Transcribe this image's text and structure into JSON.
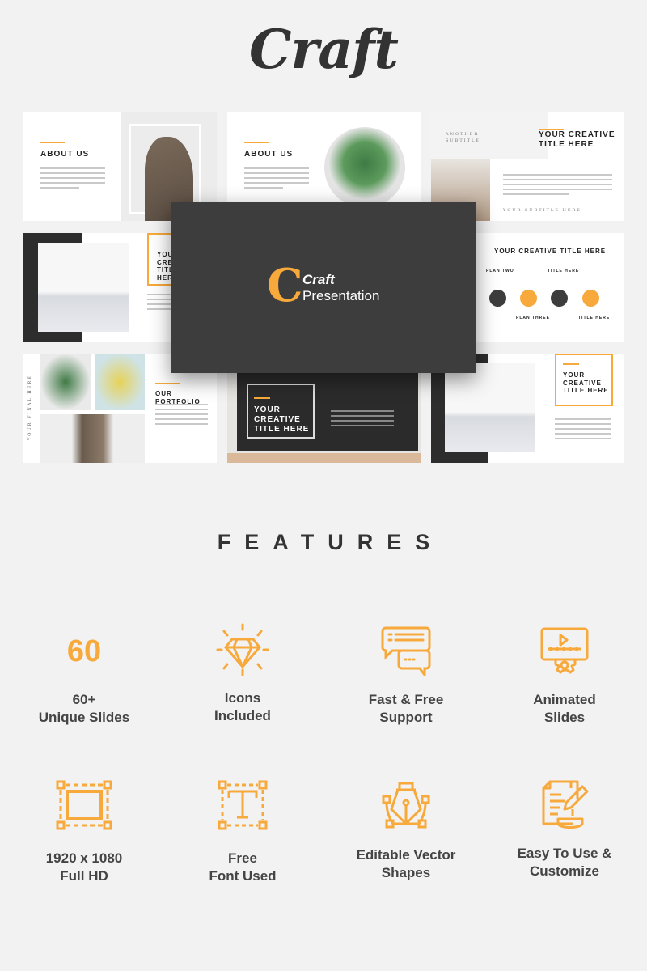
{
  "brand": "Craft",
  "accent": "#f7a93b",
  "slides": {
    "about1": "ABOUT US",
    "about2": "ABOUT US",
    "creative1_subtitle": "ANOTHER SUBTITLE",
    "creative1_title": "YOUR CREATIVE TITLE HERE",
    "creative1_footer": "YOUR SUBTITLE HERE",
    "creative2_title": "YOUR CREATIVE TITLE HERE",
    "timeline_title": "YOUR CREATIVE  TITLE HERE",
    "timeline_steps": [
      "PLAN TWO",
      "PLAN THREE",
      "TITLE HERE",
      "TITLE HERE"
    ],
    "portfolio_title": "OUR PORTFOLIO",
    "portfolio_vertical": "YOUR FINAL HERE",
    "dark_title": "YOUR CREATIVE TITLE HERE",
    "creative3_title": "YOUR CREATIVE TITLE HERE"
  },
  "hero": {
    "logo_letter": "C",
    "title": "Craft",
    "subtitle": "Presentation"
  },
  "features_title": "FEATURES",
  "features": [
    {
      "icon": "number-60",
      "value": "60",
      "line1": "60+",
      "line2": "Unique Slides"
    },
    {
      "icon": "diamond-icon",
      "line1": "Icons",
      "line2": "Included"
    },
    {
      "icon": "chat-bubbles-icon",
      "line1": "Fast & Free",
      "line2": "Support"
    },
    {
      "icon": "animated-monitor-gear-icon",
      "line1": "Animated",
      "line2": "Slides"
    },
    {
      "icon": "frame-resize-icon",
      "line1": "1920 x 1080",
      "line2": "Full HD"
    },
    {
      "icon": "text-frame-icon",
      "line1": "Free",
      "line2": "Font Used"
    },
    {
      "icon": "pen-nib-icon",
      "line1": "Editable Vector",
      "line2": "Shapes"
    },
    {
      "icon": "document-pencil-icon",
      "line1": "Easy To Use &",
      "line2": "Customize"
    }
  ]
}
